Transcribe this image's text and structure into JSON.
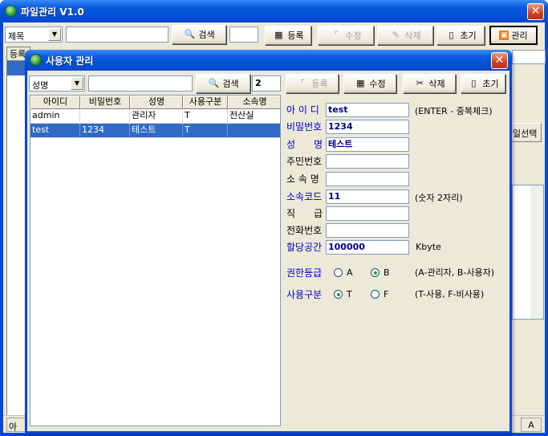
{
  "main": {
    "title": "파일관리 V1.0",
    "search_field": "제목",
    "search_button": "검색",
    "buttons": {
      "register": "등록",
      "edit": "수정",
      "delete": "삭제",
      "reset": "초기",
      "admin": "관리"
    },
    "grid_header": "등록",
    "right_button": "일선택",
    "status_left": "아이",
    "status_right": "A"
  },
  "dialog": {
    "title": "사용자 관리",
    "search_field": "성명",
    "search_button": "검색",
    "count": "2",
    "buttons": {
      "register": "등록",
      "edit": "수정",
      "delete": "삭제",
      "reset": "초기"
    },
    "columns": [
      "아이디",
      "비밀번호",
      "성명",
      "사용구분",
      "소속명"
    ],
    "rows": [
      [
        "admin",
        "",
        "관리자",
        "T",
        "전산실"
      ],
      [
        "test",
        "1234",
        "테스트",
        "T",
        ""
      ]
    ],
    "form": {
      "id_label": "아 이 디",
      "id_value": "test",
      "id_hint": "(ENTER - 중복체크)",
      "pw_label": "비밀번호",
      "pw_value": "1234",
      "name_label_1": "성",
      "name_label_2": "명",
      "name_value": "테스트",
      "rrn_label": "주민번호",
      "dept_label": "소 속 명",
      "dept_code_label": "소속코드",
      "dept_code_value": "11",
      "dept_code_hint": "(숫자 2자리)",
      "position_label_1": "직",
      "position_label_2": "급",
      "phone_label": "전화번호",
      "quota_label": "할당공간",
      "quota_value": "100000",
      "quota_unit": "Kbyte",
      "grade_label": "권한등급",
      "grade_a": "A",
      "grade_b": "B",
      "grade_hint": "(A-관리자, B-사용자)",
      "usage_label": "사용구분",
      "usage_t": "T",
      "usage_f": "F",
      "usage_hint": "(T-사용, F-비사용)"
    }
  }
}
